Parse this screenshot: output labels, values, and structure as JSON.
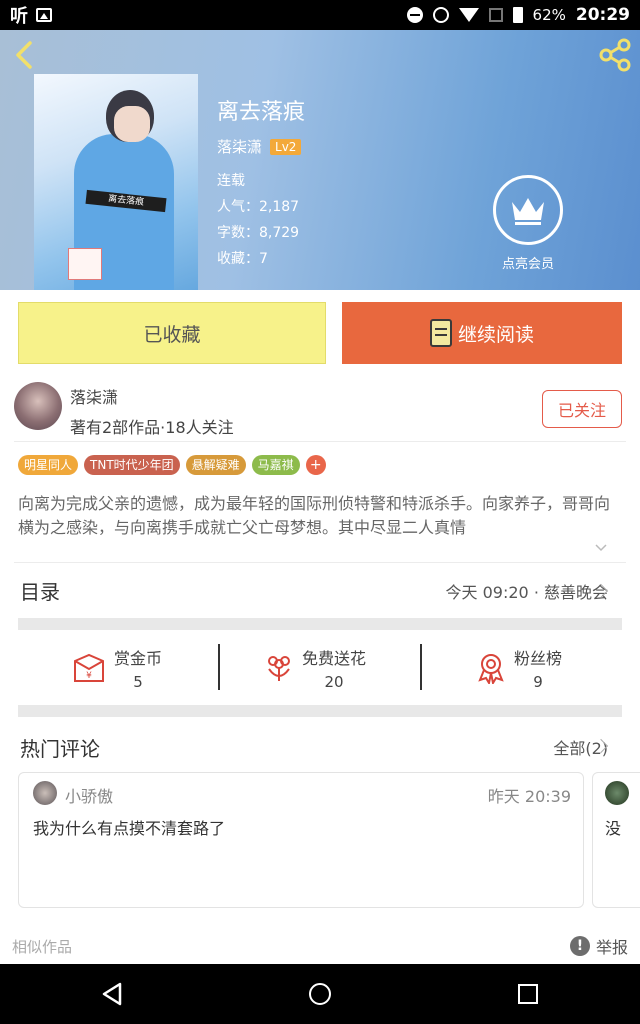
{
  "status_bar": {
    "app_glyph": "听",
    "battery": "62%",
    "time": "20:29"
  },
  "book": {
    "title": "离去落痕",
    "author": "落柒潇",
    "level": "Lv2",
    "status": "连载",
    "popularity": "人气：2,187",
    "word_count": "字数：8,729",
    "favorites": "收藏：7",
    "cover_text": "离去落痕",
    "vip_label": "点亮会员"
  },
  "actions": {
    "favorite_label": "已收藏",
    "read_label": "继续阅读"
  },
  "author_card": {
    "name": "落柒潇",
    "stats": "著有2部作品·18人关注",
    "follow_label": "已关注"
  },
  "tags": [
    {
      "label": "明星同人",
      "color": "#f0a83a"
    },
    {
      "label": "TNT时代少年团",
      "color": "#c9624f"
    },
    {
      "label": "悬解疑难",
      "color": "#d79a3a"
    },
    {
      "label": "马嘉祺",
      "color": "#8dbb4b"
    }
  ],
  "tag_add": "+",
  "description": "向离为完成父亲的遗憾，成为最年轻的国际刑侦特警和特派杀手。向家养子，哥哥向横为之感染，与向离携手成就亡父亡母梦想。其中尽显二人真情",
  "toc": {
    "title": "目录",
    "latest": "今天 09:20 · 慈善晚会"
  },
  "stats": [
    {
      "label": "赏金币",
      "value": "5",
      "icon": "red-envelope-icon"
    },
    {
      "label": "免费送花",
      "value": "20",
      "icon": "flower-icon"
    },
    {
      "label": "粉丝榜",
      "value": "9",
      "icon": "medal-icon"
    }
  ],
  "comments": {
    "title": "热门评论",
    "all_label": "全部(2)",
    "items": [
      {
        "user": "小骄傲",
        "time": "昨天 20:39",
        "text": "我为什么有点摸不清套路了"
      },
      {
        "user": "",
        "time": "",
        "text": "没"
      }
    ]
  },
  "footer": {
    "similar": "相似作品",
    "report": "举报",
    "report_icon_glyph": "!"
  },
  "colors": {
    "accent_orange": "#e8683e",
    "fav_yellow": "#f7f28a",
    "follow_red": "#e45b4a",
    "icon_red": "#d9453a"
  }
}
